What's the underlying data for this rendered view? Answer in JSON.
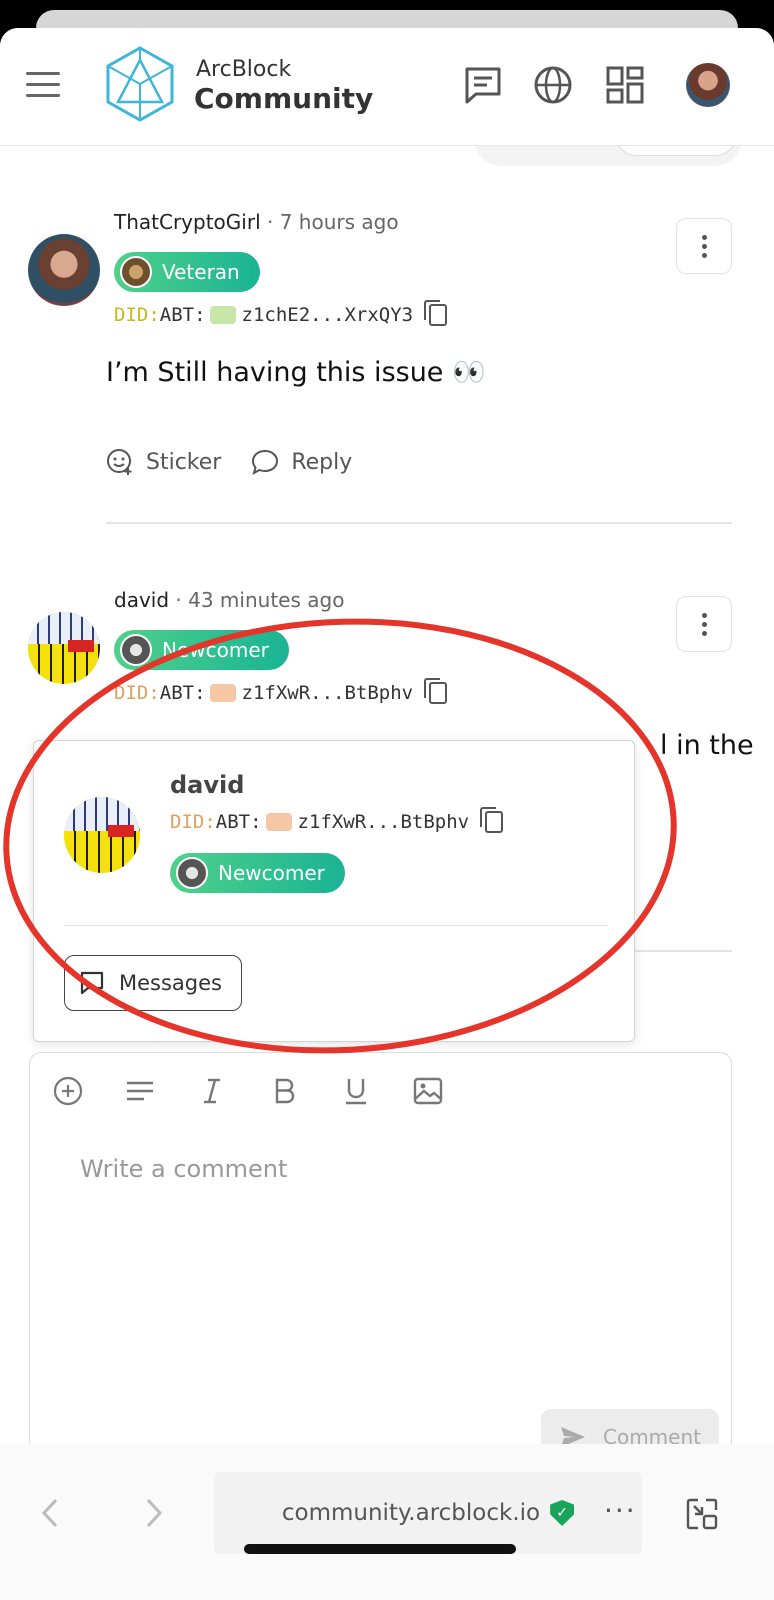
{
  "header": {
    "brand_top": "ArcBlock",
    "brand_bottom": "Community",
    "icons": [
      "menu-icon",
      "chat-icon",
      "globe-icon",
      "apps-grid-icon"
    ]
  },
  "comments": [
    {
      "author": "ThatCryptoGirl",
      "time": "· 7 hours ago",
      "badge": "Veteran",
      "did_prefix": "DID:",
      "did_chain": "ABT:",
      "did_value": "z1chE2...XrxQY3",
      "body": "I’m Still having this issue 👀",
      "actions": {
        "sticker": "Sticker",
        "reply": "Reply"
      }
    },
    {
      "author": "david",
      "time": "· 43 minutes ago",
      "badge": "Newcomer",
      "did_prefix": "DID:",
      "did_chain": "ABT:",
      "did_value": "z1fXwR...BtBphv",
      "body_trailing": "l in the"
    }
  ],
  "popover": {
    "name": "david",
    "did_prefix": "DID:",
    "did_chain": "ABT:",
    "did_value": "z1fXwR...BtBphv",
    "badge": "Newcomer",
    "messages_label": "Messages"
  },
  "editor": {
    "placeholder": "Write a comment",
    "submit_label": "Comment",
    "tools": [
      "add-circle-icon",
      "align-icon",
      "italic-icon",
      "bold-icon",
      "underline-icon",
      "image-icon"
    ]
  },
  "browser": {
    "url": "community.arcblock.io",
    "more": "···"
  },
  "colors": {
    "badge_gradient_start": "#4fd18a",
    "badge_gradient_end": "#1ab394",
    "annotation_red": "#e5352b",
    "secure_green": "#1aa35a"
  }
}
